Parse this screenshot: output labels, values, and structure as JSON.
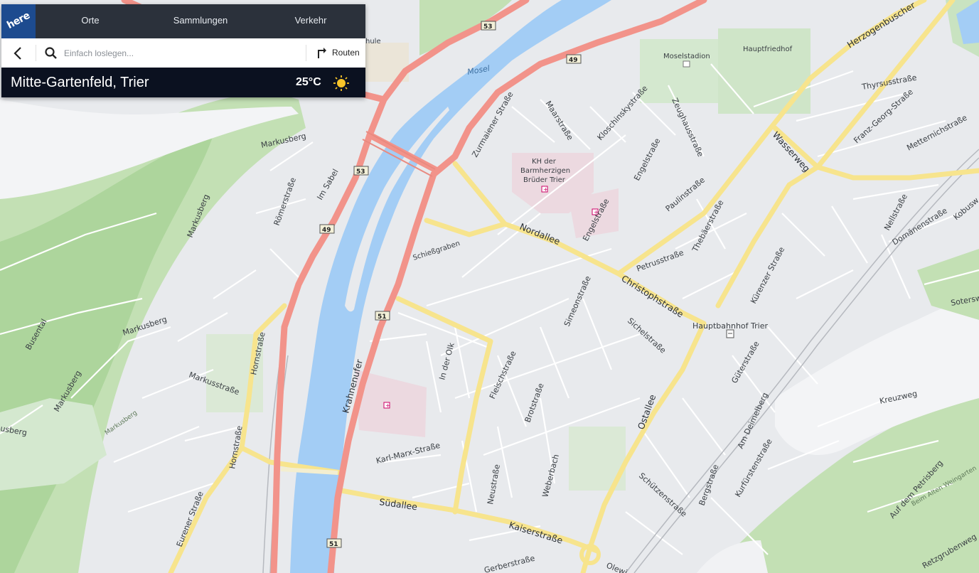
{
  "app": {
    "logo_text": "here",
    "nav": [
      {
        "label": "Orte"
      },
      {
        "label": "Sammlungen"
      },
      {
        "label": "Verkehr"
      }
    ]
  },
  "search": {
    "placeholder": "Einfach loslegen...",
    "value": "",
    "route_label": "Routen"
  },
  "location": {
    "name": "Mitte-Gartenfeld, Trier",
    "temperature": "25°C",
    "weather_icon": "sun-icon"
  },
  "map": {
    "river_label": "Mosel",
    "shields": [
      "53",
      "49",
      "53",
      "49",
      "51",
      "51"
    ],
    "streets": [
      "Nordallee",
      "Christophstraße",
      "Ostallee",
      "Südallee",
      "Kaiserstraße",
      "Krahnenufer",
      "Wasserweg",
      "Herzogenbuscher",
      "Paulinstraße",
      "Zurmaiener Straße",
      "Maarstraße",
      "Kloschinskystraße",
      "Zeughausstraße",
      "Engelstraße",
      "Engelstraße",
      "Thyrsusstraße",
      "Franz-Georg-Straße",
      "Metternichstraße",
      "Nellstraße",
      "Domänenstraße",
      "Kobusw",
      "Thebäerstraße",
      "Petrusstraße",
      "Kürenzer Straße",
      "Simeonstraße",
      "Sichelstraße",
      "Hauptbahnhof Trier",
      "Güterstraße",
      "Am Deimelberg",
      "Kreuzweg",
      "Kurfürstenstraße",
      "Bergstraße",
      "Schützenstraße",
      "Weberbach",
      "Brotstraße",
      "Fleischstraße",
      "In der Olk",
      "Neustraße",
      "Karl-Marx-Straße",
      "Hornstraße",
      "Hornstraße",
      "Eurener Straße",
      "Markusstraße",
      "Markusberg",
      "Markusberg",
      "Markusberg",
      "Markusberg",
      "Busental",
      "Römerstraße",
      "Im Sabel",
      "Schießgraben",
      "Gerberstraße",
      "Auf dem Petrisberg",
      "Beim Alten Weingarten",
      "Retzgrubenweg",
      "Sotersw",
      "Olewi",
      "Moselstadion",
      "Hauptfriedhof",
      "KH der",
      "Barmherzigen",
      "Brüder Trier",
      "Markusberg",
      "usberg",
      "hule"
    ]
  },
  "colors": {
    "water": "#a3cdf5",
    "land": "#e8eaed",
    "park": "#c9e3c1",
    "forest": "#b6d9a8",
    "major_road": "#f2938a",
    "main_road": "#f7e48d",
    "hospital": "#ecd9e0",
    "nav_bg": "#2b313b",
    "info_bg": "#0b1120",
    "logo_bg": "#1d4b8f"
  }
}
